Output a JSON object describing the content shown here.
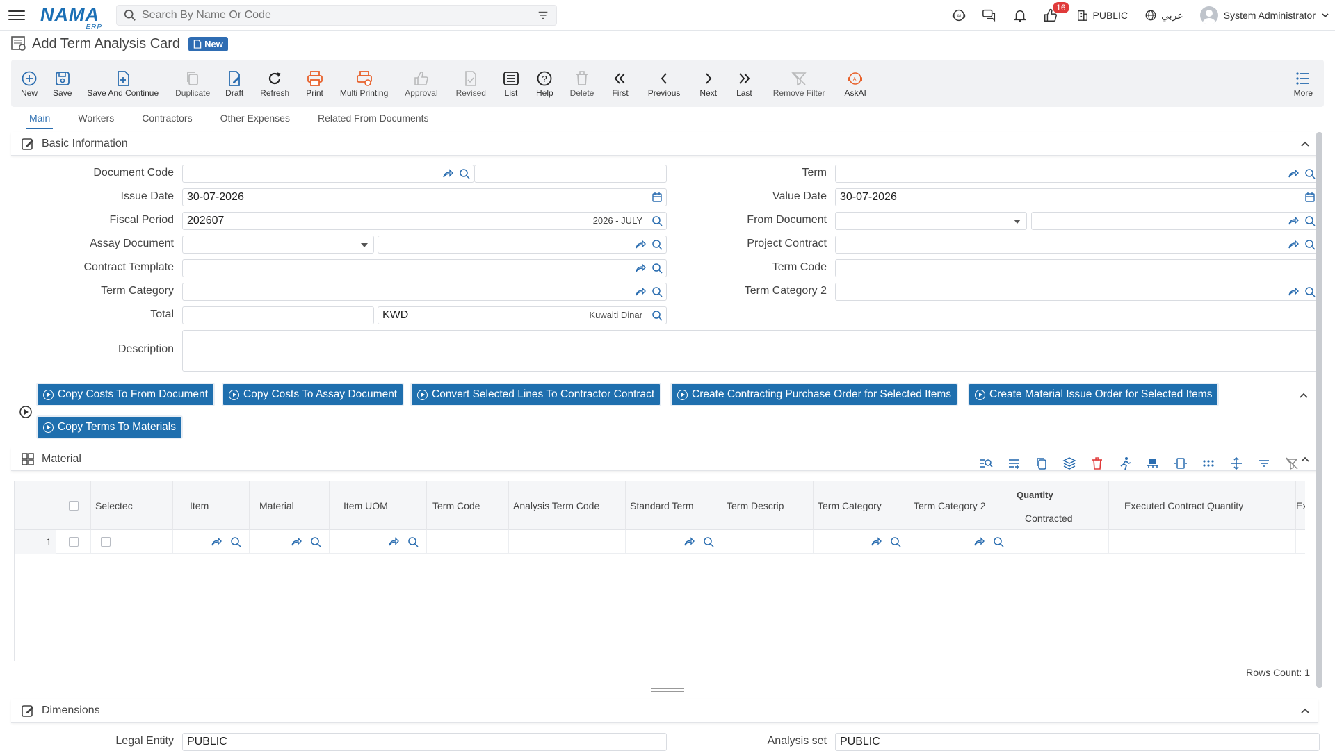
{
  "topbar": {
    "logo": "NAMA",
    "logo_sub": "ERP",
    "search_placeholder": "Search By Name Or Code",
    "notif_count": "16",
    "branch": "PUBLIC",
    "language": "عربي",
    "user": "System Administrator"
  },
  "page": {
    "title": "Add Term Analysis Card",
    "status": "New"
  },
  "toolbar": [
    {
      "label": "New",
      "icon": "plus-circle-icon"
    },
    {
      "label": "Save",
      "icon": "save-icon"
    },
    {
      "label": "Save And Continue",
      "icon": "save-continue-icon"
    },
    {
      "label": "Duplicate",
      "icon": "duplicate-icon"
    },
    {
      "label": "Draft",
      "icon": "draft-icon"
    },
    {
      "label": "Refresh",
      "icon": "refresh-icon"
    },
    {
      "label": "Print",
      "icon": "print-icon"
    },
    {
      "label": "Multi Printing",
      "icon": "multi-print-icon"
    },
    {
      "label": "Approval",
      "icon": "thumbs-up-icon"
    },
    {
      "label": "Revised",
      "icon": "revised-icon"
    },
    {
      "label": "List",
      "icon": "list-icon"
    },
    {
      "label": "Help",
      "icon": "help-icon"
    },
    {
      "label": "Delete",
      "icon": "trash-icon"
    },
    {
      "label": "First",
      "icon": "first-icon"
    },
    {
      "label": "Previous",
      "icon": "previous-icon"
    },
    {
      "label": "Next",
      "icon": "next-icon"
    },
    {
      "label": "Last",
      "icon": "last-icon"
    },
    {
      "label": "Remove Filter",
      "icon": "remove-filter-icon"
    },
    {
      "label": "AskAI",
      "icon": "ai-icon"
    },
    {
      "label": "More",
      "icon": "more-icon"
    }
  ],
  "tabs": [
    "Main",
    "Workers",
    "Contractors",
    "Other Expenses",
    "Related From Documents"
  ],
  "basic": {
    "title": "Basic Information",
    "labels": {
      "document_code": "Document Code",
      "issue_date": "Issue Date",
      "fiscal_period": "Fiscal Period",
      "assay_document": "Assay Document",
      "contract_template": "Contract Template",
      "term_category": "Term Category",
      "total": "Total",
      "description": "Description",
      "term": "Term",
      "value_date": "Value Date",
      "from_document": "From Document",
      "project_contract": "Project Contract",
      "term_code": "Term Code",
      "term_category_2": "Term Category 2"
    },
    "values": {
      "issue_date": "30-07-2026",
      "fiscal_period": "202607",
      "fiscal_period_desc": "2026 - JULY",
      "currency": "KWD",
      "currency_desc": "Kuwaiti Dinar",
      "value_date": "30-07-2026"
    }
  },
  "actions": [
    "Copy Costs To From Document",
    "Copy Costs To Assay Document",
    "Convert Selected Lines To Contractor Contract",
    "Create Contracting Purchase Order for Selected Items",
    "Create Material Issue Order for Selected Items",
    "Copy Terms To Materials"
  ],
  "material": {
    "title": "Material",
    "columns": {
      "selected": "Selectec",
      "item": "Item",
      "material": "Material",
      "item_uom": "Item UOM",
      "term_code": "Term Code",
      "analysis_term_code": "Analysis Term Code",
      "standard_term": "Standard Term",
      "term_description": "Term Descrip",
      "term_category": "Term Category",
      "term_category_2": "Term Category 2",
      "quantity_group": "Quantity",
      "contracted": "Contracted",
      "executed_contract_quantity": "Executed Contract Quantity",
      "exec": "Exec"
    },
    "row_number": "1",
    "rows_count": "Rows Count: 1"
  },
  "dimensions": {
    "title": "Dimensions",
    "legal_entity_label": "Legal Entity",
    "legal_entity_value": "PUBLIC",
    "analysis_set_label": "Analysis set",
    "analysis_set_value": "PUBLIC"
  }
}
